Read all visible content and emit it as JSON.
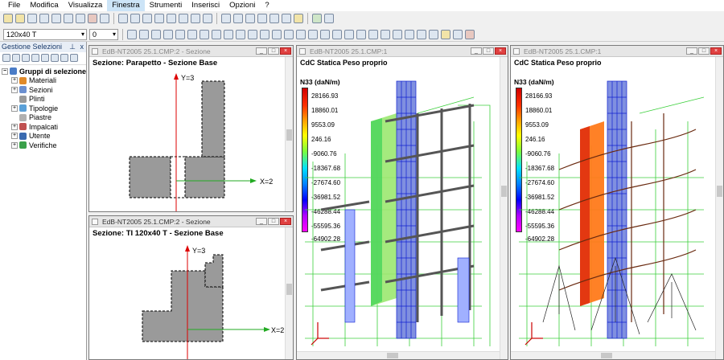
{
  "menu": [
    "File",
    "Modifica",
    "Visualizza",
    "Finestra",
    "Strumenti",
    "Inserisci",
    "Opzioni",
    "?"
  ],
  "toolbar": {
    "section_combo": "120x40 T",
    "level_combo": "0"
  },
  "panel": {
    "title": "Gestione Selezioni",
    "pin": "⊥",
    "close": "x"
  },
  "tree": {
    "root": "Gruppi di selezione",
    "items": [
      "Materiali",
      "Sezioni",
      "Plinti",
      "Tipologie",
      "Piastre",
      "Impalcati",
      "Utente",
      "Verifiche"
    ]
  },
  "win1": {
    "title": "EdB-NT2005 25.1.CMP:2 - Sezione",
    "heading": "Sezione: Parapetto - Sezione Base",
    "y_axis": "Y=3",
    "x_axis": "X=2"
  },
  "win2": {
    "title": "EdB-NT2005 25.1.CMP:2 - Sezione",
    "heading": "Sezione: TI 120x40 T - Sezione Base",
    "y_axis": "Y=3",
    "x_axis": "X=2"
  },
  "win3": {
    "title": "EdB-NT2005 25.1.CMP:1",
    "heading": "CdC Statica Peso proprio",
    "unit": "N33 (daN/m)"
  },
  "win4": {
    "title": "EdB-NT2005 25.1.CMP:1",
    "heading": "CdC Statica Peso proprio",
    "unit": "N33 (daN/m)"
  },
  "legend": [
    "28166.93",
    "18860.01",
    "9553.09",
    "246.16",
    "-9060.76",
    "-18367.68",
    "-27674.60",
    "-36981.52",
    "-46288.44",
    "-55595.36",
    "-64902.28"
  ],
  "colors": {
    "accent": "#cce4f7",
    "max": "#d00000",
    "min": "#ff00ff"
  }
}
